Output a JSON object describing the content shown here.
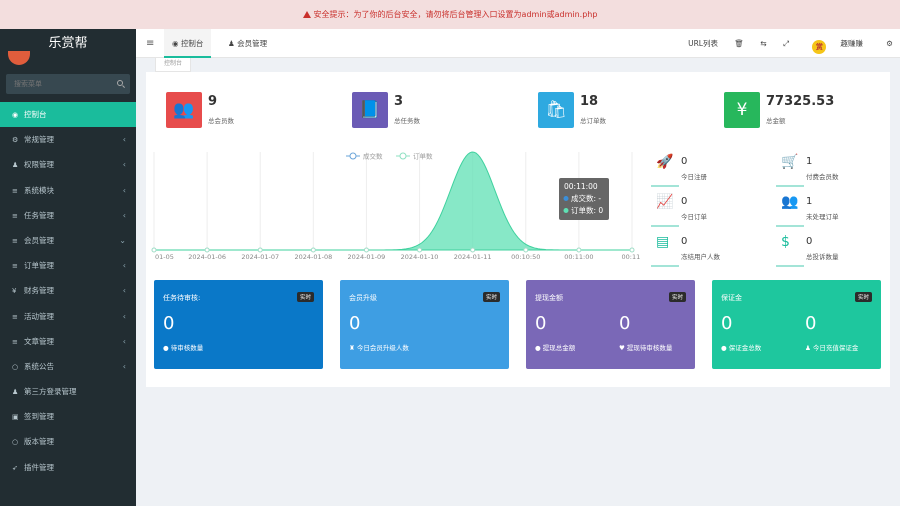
{
  "alert": {
    "text": "安全提示：为了你的后台安全，请勿将后台管理入口设置为admin或admin.php"
  },
  "sidebar": {
    "logo": "乐赏帮",
    "search_placeholder": "搜索菜单",
    "items": [
      {
        "icon": "dashboard-icon",
        "glyph": "◉",
        "label": "控制台",
        "active": true,
        "arrow": ""
      },
      {
        "icon": "gears-icon",
        "glyph": "⚙",
        "label": "常规管理",
        "arrow": "‹"
      },
      {
        "icon": "users-icon",
        "glyph": "♟",
        "label": "权限管理",
        "arrow": "‹"
      },
      {
        "icon": "list-icon",
        "glyph": "≡",
        "label": "系统模块",
        "arrow": "‹"
      },
      {
        "icon": "list-icon",
        "glyph": "≡",
        "label": "任务管理",
        "arrow": "‹"
      },
      {
        "icon": "list-icon",
        "glyph": "≡",
        "label": "会员管理",
        "arrow": "⌄"
      },
      {
        "icon": "list-icon",
        "glyph": "≡",
        "label": "订单管理",
        "arrow": "‹"
      },
      {
        "icon": "yen-icon",
        "glyph": "¥",
        "label": "财务管理",
        "arrow": "‹"
      },
      {
        "icon": "list-icon",
        "glyph": "≡",
        "label": "活动管理",
        "arrow": "‹"
      },
      {
        "icon": "list-icon",
        "glyph": "≡",
        "label": "文章管理",
        "arrow": "‹"
      },
      {
        "icon": "comment-icon",
        "glyph": "○",
        "label": "系统公告",
        "arrow": "‹"
      },
      {
        "icon": "users-icon",
        "glyph": "♟",
        "label": "第三方登录管理",
        "arrow": ""
      },
      {
        "icon": "calendar-icon",
        "glyph": "▣",
        "label": "签到管理",
        "arrow": ""
      },
      {
        "icon": "circle-icon",
        "glyph": "○",
        "label": "版本管理",
        "arrow": ""
      },
      {
        "icon": "rocket-icon",
        "glyph": "➶",
        "label": "插件管理",
        "arrow": ""
      }
    ]
  },
  "topbar": {
    "tabs": [
      {
        "label": "控制台"
      },
      {
        "label": "会员管理"
      }
    ],
    "url_list": "URL列表",
    "username": "趣赚赚",
    "avatar_text": "赏"
  },
  "subtab": "控制台",
  "stats": [
    {
      "value": "9",
      "label": "总会员数",
      "color": "#e74c4c",
      "icon": "users-icon",
      "glyph": "👥"
    },
    {
      "value": "3",
      "label": "总任务数",
      "color": "#6b5bb5",
      "icon": "book-icon",
      "glyph": "📘"
    },
    {
      "value": "18",
      "label": "总订单数",
      "color": "#2ea9e0",
      "icon": "shopping-bag-icon",
      "glyph": "🛍"
    },
    {
      "value": "77325.53",
      "label": "总金额",
      "color": "#27b75c",
      "icon": "yen-icon",
      "glyph": "¥"
    }
  ],
  "chart_data": {
    "type": "area",
    "legend": [
      "成交数",
      "订单数"
    ],
    "x": [
      "01-05",
      "2024-01-06",
      "2024-01-07",
      "2024-01-08",
      "2024-01-09",
      "2024-01-10",
      "2024-01-11",
      "00:10:50",
      "00:11:00",
      "00:11:"
    ],
    "series": [
      {
        "name": "成交数",
        "values": [
          0,
          0,
          0,
          0,
          0,
          0,
          0,
          0,
          0,
          0
        ]
      },
      {
        "name": "订单数",
        "values": [
          0,
          0,
          0,
          0,
          0,
          0,
          1,
          0,
          0,
          0
        ]
      }
    ],
    "tooltip": {
      "title": "00:11:00",
      "line1": "成交数: -",
      "line2": "订单数: 0"
    }
  },
  "mini_stats": [
    {
      "value": "0",
      "label": "今日注册",
      "icon": "rocket-icon",
      "glyph": "🚀"
    },
    {
      "value": "1",
      "label": "付费会员数",
      "icon": "cart-icon",
      "glyph": "🛒"
    },
    {
      "value": "0",
      "label": "今日订单",
      "icon": "line-chart-icon",
      "glyph": "📈"
    },
    {
      "value": "1",
      "label": "未处理订单",
      "icon": "users-icon",
      "glyph": "👥"
    },
    {
      "value": "0",
      "label": "冻结用户人数",
      "icon": "list-alt-icon",
      "glyph": "▤"
    },
    {
      "value": "0",
      "label": "总投诉数量",
      "icon": "dollar-icon",
      "glyph": "$"
    }
  ],
  "cards": [
    {
      "title": "任务待审核:",
      "tag": "实时",
      "color": "#0a78c8",
      "stats": [
        {
          "value": "0",
          "label": "待审核数量"
        }
      ]
    },
    {
      "title": "会员升级",
      "tag": "实时",
      "color": "#3e9ee3",
      "stats": [
        {
          "value": "0",
          "label": "今日会员升级人数"
        }
      ]
    },
    {
      "title": "提现金额",
      "tag": "实时",
      "color": "#7a68b7",
      "stats": [
        {
          "value": "0",
          "label": "提现总金额"
        },
        {
          "value": "0",
          "label": "提现待审核数量"
        }
      ]
    },
    {
      "title": "保证金",
      "tag": "实时",
      "color": "#1ec79e",
      "stats": [
        {
          "value": "0",
          "label": "保证金总数"
        },
        {
          "value": "0",
          "label": "今日充值保证金"
        }
      ]
    }
  ]
}
